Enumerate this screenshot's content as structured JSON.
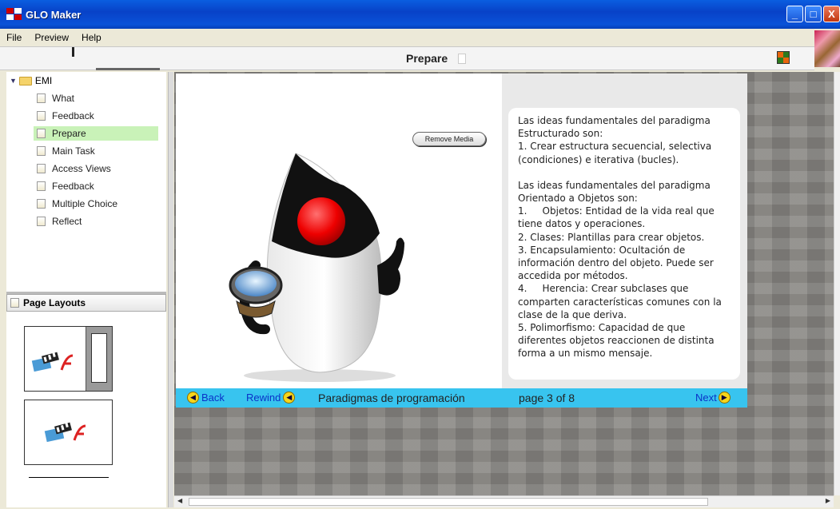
{
  "window": {
    "title": "GLO Maker",
    "minimize": "_",
    "maximize": "□",
    "close": "X"
  },
  "menu": [
    "File",
    "Preview",
    "Help"
  ],
  "header": {
    "title": "Prepare"
  },
  "tree": {
    "root": "EMI",
    "items": [
      {
        "label": "What"
      },
      {
        "label": "Feedback"
      },
      {
        "label": "Prepare",
        "selected": true
      },
      {
        "label": "Main Task"
      },
      {
        "label": "Access Views"
      },
      {
        "label": "Feedback"
      },
      {
        "label": "Multiple Choice"
      },
      {
        "label": "Reflect"
      }
    ]
  },
  "layouts": {
    "title": "Page Layouts"
  },
  "page": {
    "remove_media": "Remove Media",
    "paragraphs": [
      "Las ideas fundamentales del paradigma Estructurado son:",
      "1. Crear estructura secuencial, selectiva (condiciones) e iterativa (bucles).",
      "",
      "Las ideas fundamentales del paradigma Orientado a Objetos son:",
      "1.     Objetos: Entidad de la vida real que tiene datos y operaciones.",
      "2. Clases: Plantillas para crear objetos.",
      "3. Encapsulamiento: Ocultación de información dentro del objeto. Puede ser accedida por métodos.",
      "4.     Herencia: Crear subclases que comparten características comunes con la clase de la que deriva.",
      "5. Polimorfismo: Capacidad de que diferentes objetos reaccionen de distinta forma a un mismo mensaje."
    ]
  },
  "nav": {
    "back": "Back",
    "rewind": "Rewind",
    "topic": "Paradigmas de programación",
    "page_info": "page 3 of 8",
    "next": "Next"
  },
  "colors": {
    "nav_bar": "#38c4ef",
    "selected_item": "#c9f2b8",
    "title_bar": "#0a52d8"
  }
}
